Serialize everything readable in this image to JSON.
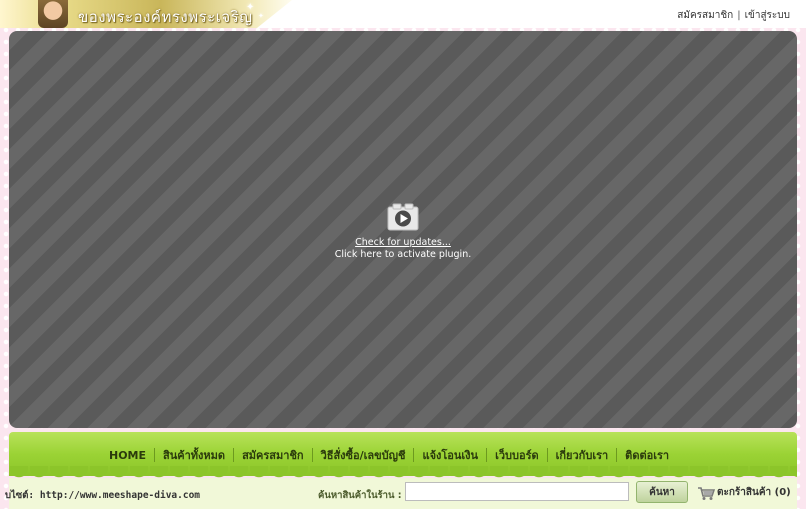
{
  "header": {
    "banner_title": "ของพระองค์ทรงพระเจริญ",
    "links": [
      "สมัครสมาชิก",
      "เข้าสู่ระบบ"
    ],
    "separator": "|"
  },
  "plugin": {
    "icon": "play-plugin-icon",
    "link_text": "Check for updates...",
    "activate_text": "Click here to activate plugin."
  },
  "nav": {
    "items": [
      "HOME",
      "สินค้าทั้งหมด",
      "สมัครสมาชิก",
      "วิธีสั่งซื้อ/เลขบัญชี",
      "แจ้งโอนเงิน",
      "เว็บบอร์ด",
      "เกี่ยวกับเรา",
      "ติดต่อเรา"
    ]
  },
  "footer": {
    "website_label": "บไซต์: http://www.meeshape-diva.com",
    "search_label": "ค้นหาสินค้าในร้าน :",
    "search_value": "",
    "search_button": "ค้นหา",
    "cart_label": "ตะกร้าสินค้า (0)"
  },
  "colors": {
    "nav_green": "#9bd335",
    "plugin_gray": "#5f5f5f",
    "page_pink": "#fbe6ef",
    "banner_gold": "#c9b65a"
  }
}
